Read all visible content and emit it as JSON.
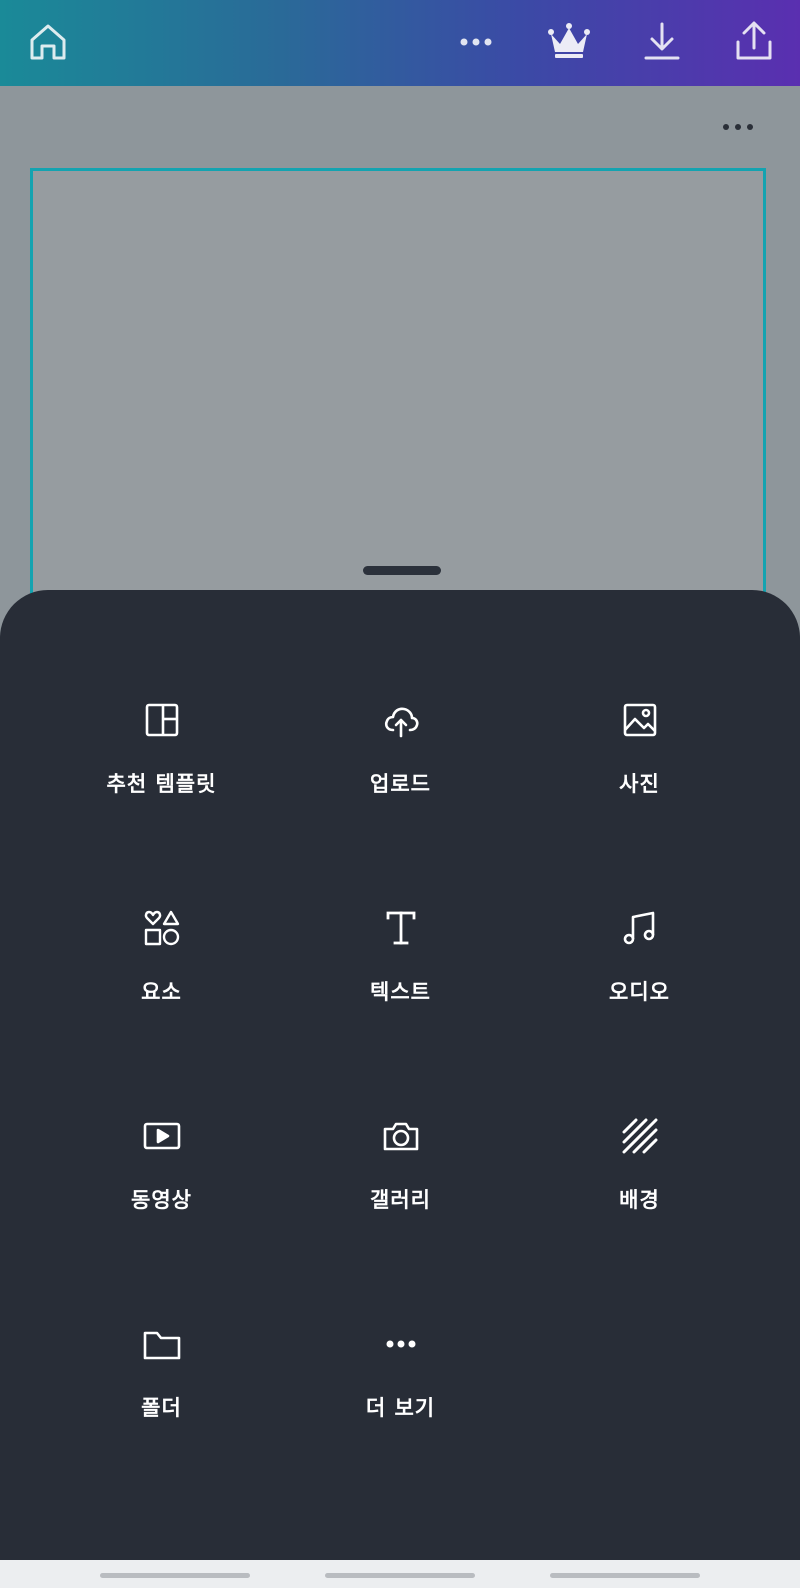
{
  "colors": {
    "gradient_start": "#1a8a98",
    "gradient_end": "#5a2fb0",
    "sheet_bg": "#282d37",
    "canvas_bg": "#8e969b",
    "selection_border": "#14a3b0"
  },
  "toolbar": {
    "icons": [
      "home-icon",
      "more-icon",
      "crown-icon",
      "download-icon",
      "share-icon"
    ]
  },
  "menu": {
    "items": [
      {
        "label": "추천 템플릿",
        "icon": "template-icon"
      },
      {
        "label": "업로드",
        "icon": "upload-cloud-icon"
      },
      {
        "label": "사진",
        "icon": "image-icon"
      },
      {
        "label": "요소",
        "icon": "elements-icon"
      },
      {
        "label": "텍스트",
        "icon": "text-icon"
      },
      {
        "label": "오디오",
        "icon": "music-icon"
      },
      {
        "label": "동영상",
        "icon": "video-icon"
      },
      {
        "label": "갤러리",
        "icon": "camera-icon"
      },
      {
        "label": "배경",
        "icon": "background-icon"
      },
      {
        "label": "폴더",
        "icon": "folder-icon"
      },
      {
        "label": "더 보기",
        "icon": "more-icon"
      }
    ]
  }
}
